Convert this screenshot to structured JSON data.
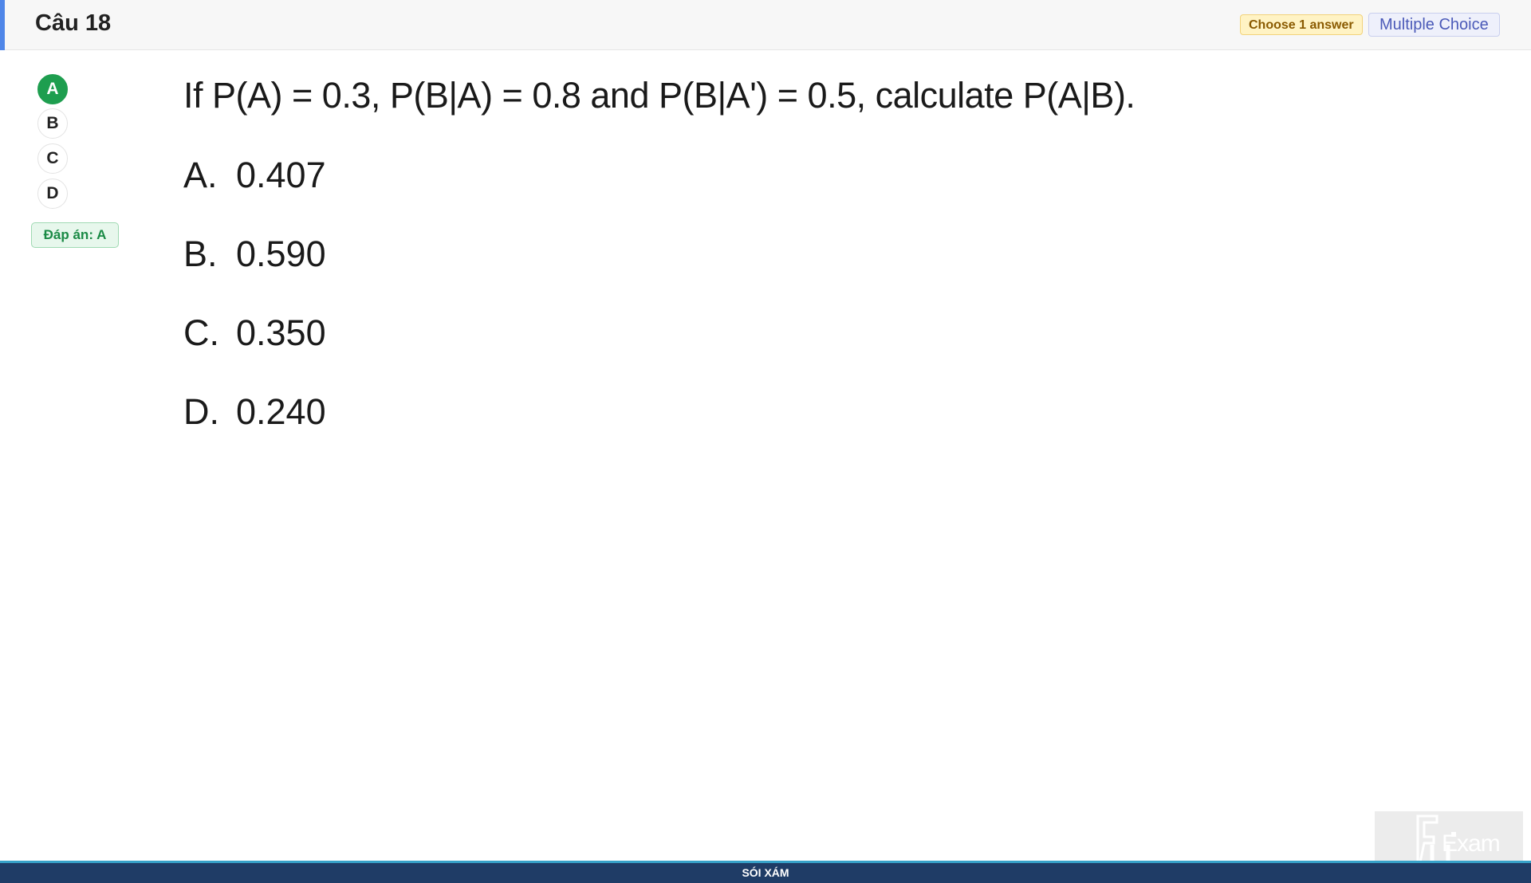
{
  "header": {
    "title": "Câu 18",
    "choose_badge": "Choose 1 answer",
    "type_badge": "Multiple Choice"
  },
  "answer_sidebar": {
    "options": [
      "A",
      "B",
      "C",
      "D"
    ],
    "selected": "A",
    "answer_label": "Đáp án: A"
  },
  "question": {
    "text": "If P(A) = 0.3, P(B|A) = 0.8 and P(B|A') = 0.5, calculate P(A|B).",
    "choices": [
      {
        "letter": "A.",
        "value": "0.407"
      },
      {
        "letter": "B.",
        "value": "0.590"
      },
      {
        "letter": "C.",
        "value": "0.350"
      },
      {
        "letter": "D.",
        "value": "0.240"
      }
    ]
  },
  "watermark": {
    "text": "Exam"
  },
  "footer": {
    "text": "SÓI XÁM"
  },
  "colors": {
    "header_accent": "#4f86e8",
    "selected_green": "#1e9e4f",
    "footer_bg": "#1f3c66"
  }
}
